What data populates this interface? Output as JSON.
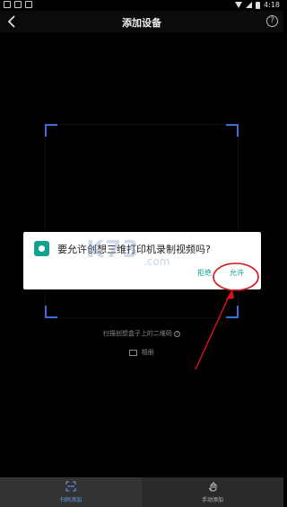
{
  "status_bar": {
    "time": "4:18"
  },
  "header": {
    "title": "添加设备",
    "help_symbol": "?"
  },
  "scanner": {
    "hint": "扫描创想盒子上的二维码",
    "hint_info_symbol": "?",
    "album_label": "相册"
  },
  "dialog": {
    "message": "要允许创想三维打印机录制视频吗?",
    "deny_label": "拒绝",
    "allow_label": "允许",
    "icon": "camera-icon"
  },
  "watermark": {
    "main": "K73",
    "sub": ".com"
  },
  "bottom_tabs": [
    {
      "label": "扫码添加",
      "icon": "scan-icon",
      "active": true
    },
    {
      "label": "手动添加",
      "icon": "hand-icon",
      "active": false
    }
  ],
  "colors": {
    "accent": "#13a192",
    "scan_corner": "#3b6fd4",
    "annotation": "#d8141c",
    "active_tab": "#6a9cf0"
  }
}
